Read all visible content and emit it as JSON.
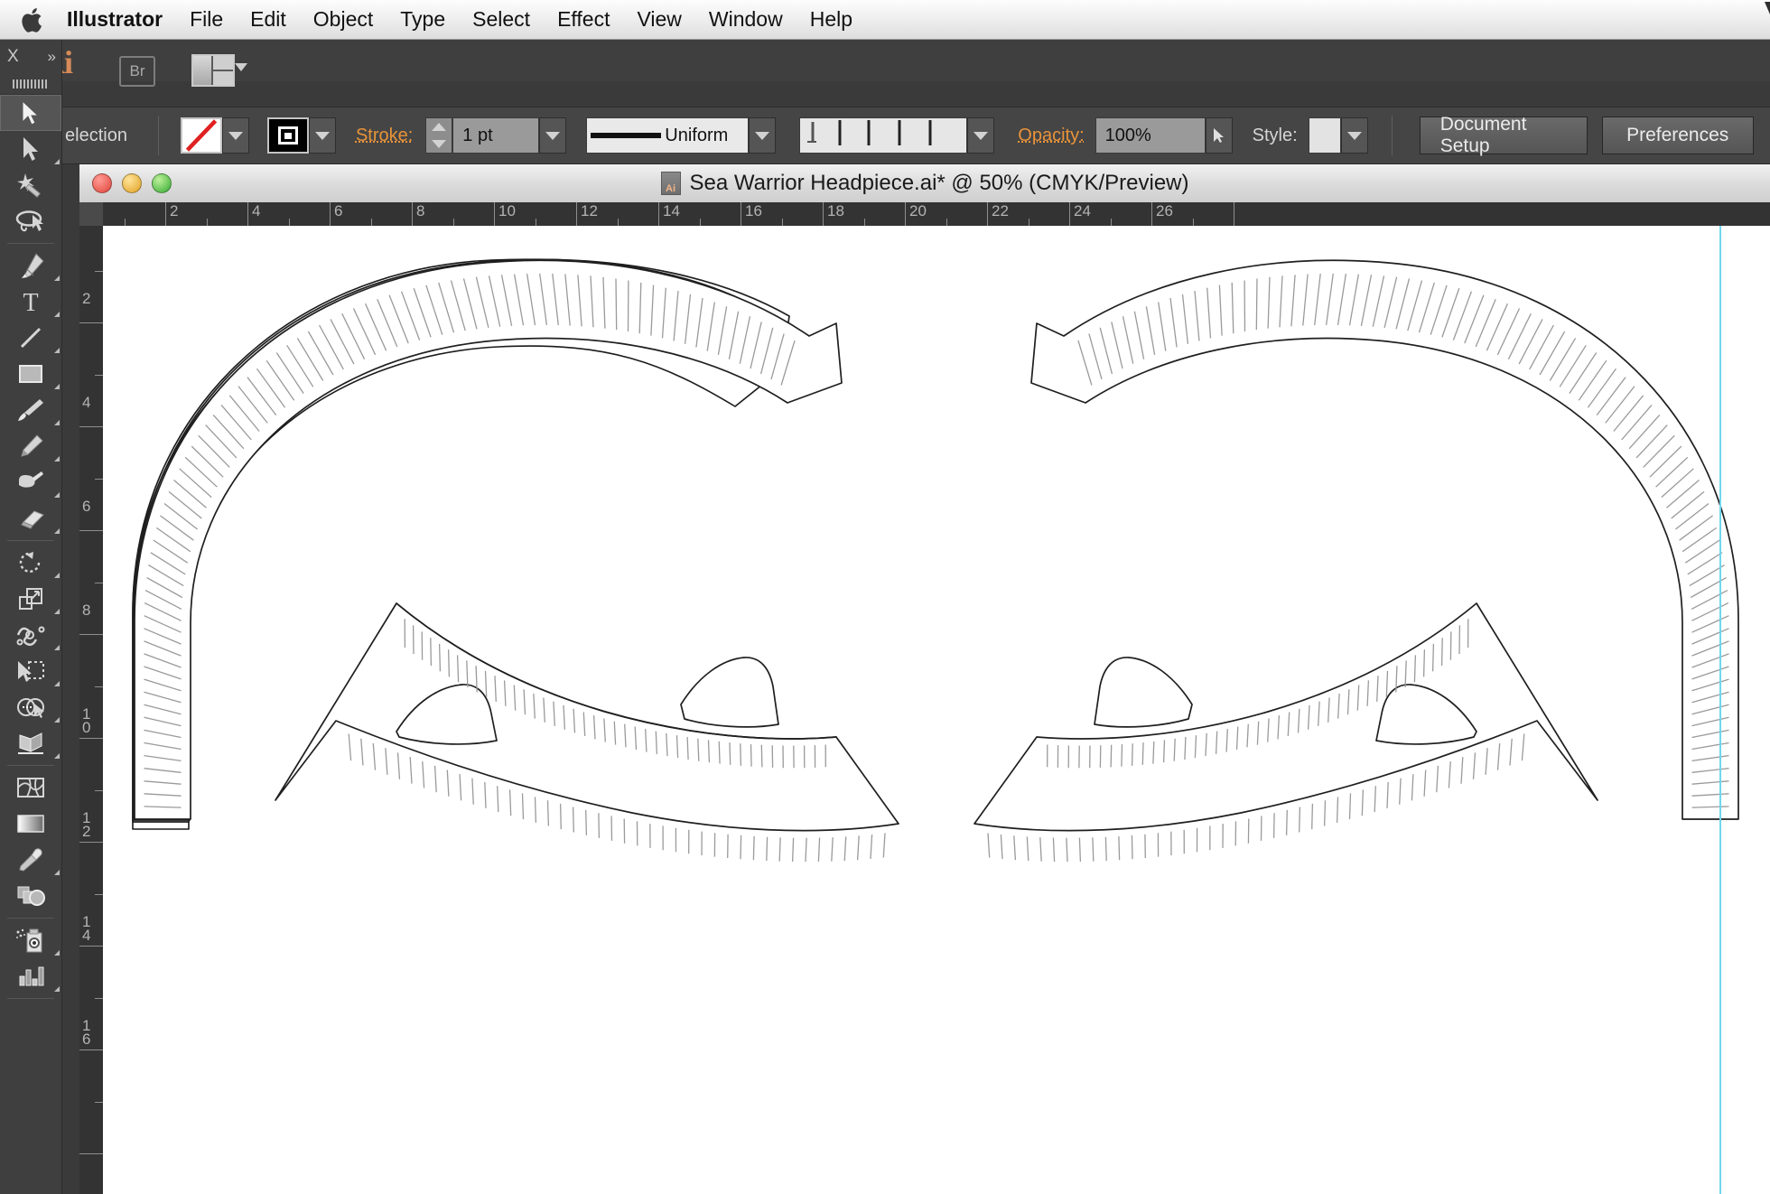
{
  "menubar": {
    "apple_icon": "apple-logo",
    "items": [
      {
        "label": "Illustrator",
        "bold": true
      },
      {
        "label": "File"
      },
      {
        "label": "Edit"
      },
      {
        "label": "Object"
      },
      {
        "label": "Type"
      },
      {
        "label": "Select"
      },
      {
        "label": "Effect"
      },
      {
        "label": "View"
      },
      {
        "label": "Window"
      },
      {
        "label": "Help"
      }
    ]
  },
  "appbar": {
    "logo": "Ai",
    "bridge_label": "Br",
    "arrange_icon": "arrange-documents-icon"
  },
  "control": {
    "selection_label": "election",
    "fill_swatch": "none-fill-red-slash",
    "stroke_swatch": "black-stroke",
    "stroke_label": "Stroke:",
    "stroke_weight": "1 pt",
    "profile_label": "Uniform",
    "variable_width_profile": "width-profile-icon",
    "opacity_label": "Opacity:",
    "opacity_value": "100%",
    "style_label": "Style:",
    "document_setup_label": "Document Setup",
    "preferences_label": "Preferences"
  },
  "toolpanel": {
    "close_label": "X",
    "expand_label": "»",
    "tools": [
      {
        "name": "selection-tool",
        "selected": true
      },
      {
        "name": "direct-selection-tool"
      },
      {
        "name": "magic-wand-tool"
      },
      {
        "name": "lasso-tool"
      },
      {
        "name": "pen-tool"
      },
      {
        "name": "type-tool"
      },
      {
        "name": "line-segment-tool"
      },
      {
        "name": "rectangle-tool"
      },
      {
        "name": "paintbrush-tool"
      },
      {
        "name": "pencil-tool"
      },
      {
        "name": "blob-brush-tool"
      },
      {
        "name": "eraser-tool"
      },
      {
        "name": "rotate-tool"
      },
      {
        "name": "scale-tool"
      },
      {
        "name": "width-tool"
      },
      {
        "name": "free-transform-tool"
      },
      {
        "name": "shape-builder-tool"
      },
      {
        "name": "perspective-grid-tool"
      },
      {
        "name": "mesh-tool"
      },
      {
        "name": "gradient-tool"
      },
      {
        "name": "eyedropper-tool"
      },
      {
        "name": "blend-tool"
      },
      {
        "name": "symbol-sprayer-tool"
      },
      {
        "name": "column-graph-tool"
      }
    ]
  },
  "document": {
    "title": "Sea Warrior Headpiece.ai* @ 50% (CMYK/Preview)",
    "file_icon": "Ai",
    "zoom": "50%",
    "color_mode": "CMYK",
    "view_mode": "Preview",
    "window_buttons": [
      "close",
      "minimize",
      "zoom"
    ]
  },
  "rulers": {
    "horizontal_units": [
      2,
      4,
      6,
      8,
      10,
      12,
      14,
      16,
      18,
      20,
      22,
      24,
      26
    ],
    "vertical_units": [
      2,
      4,
      6,
      8,
      10,
      12,
      14,
      16
    ],
    "origin_x": 0,
    "origin_y": 0
  },
  "canvas": {
    "guide_color": "#6fd6ee",
    "artwork_name": "sea-warrior-headpiece-outline",
    "artwork_description": "Symmetric pair of curved horn/wing pattern pieces with stitch-line hatch marks"
  }
}
